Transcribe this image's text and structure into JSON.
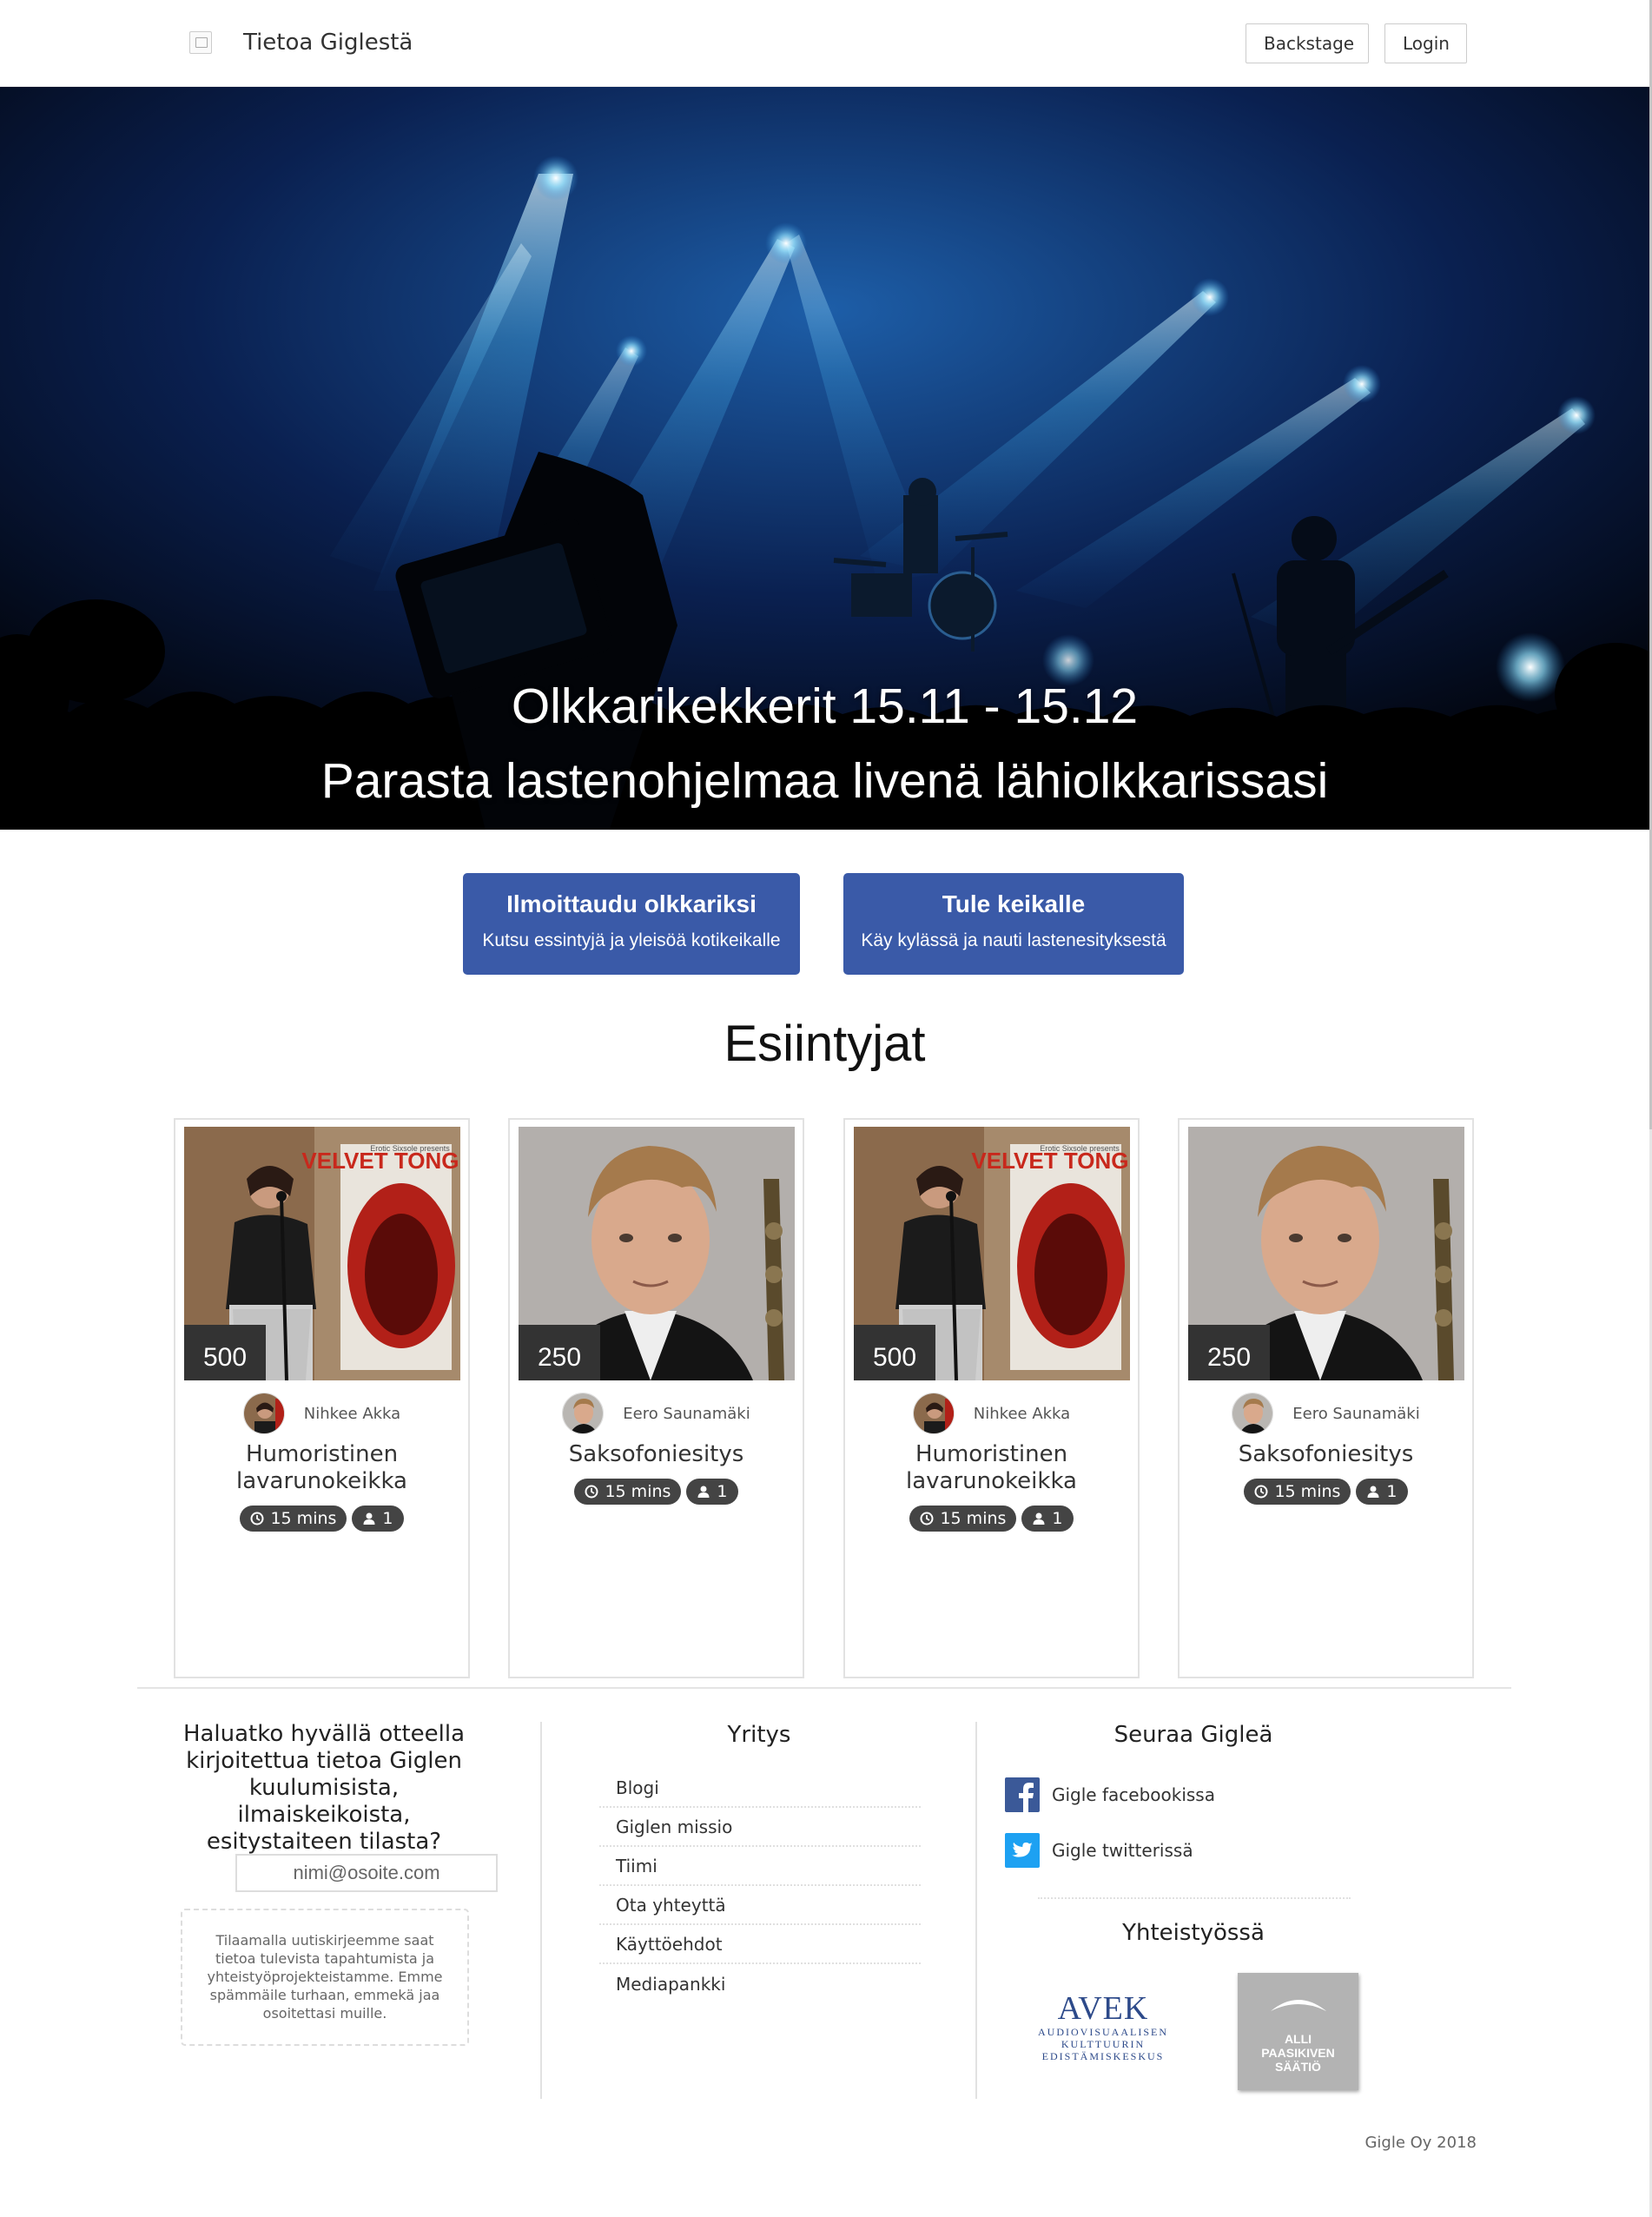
{
  "header": {
    "brand_title": "Tietoa Giglestä",
    "buttons": {
      "backstage": "Backstage",
      "login": "Login"
    }
  },
  "hero": {
    "line1": "Olkkarikekkerit 15.11 - 15.12",
    "line2": "Parasta lastenohjelmaa livenä lähiolkkarissasi"
  },
  "cta": [
    {
      "title": "Ilmoittaudu olkkariksi",
      "subtitle": "Kutsu essintyjä ja yleisöä kotikeikalle"
    },
    {
      "title": "Tule keikalle",
      "subtitle": "Käy kylässä ja nauti lastenesityksestä"
    }
  ],
  "performers_section": {
    "title": "Esiintyjat",
    "cards": [
      {
        "price": "500",
        "performer": "Nihkee Akka",
        "title": "Humoristinen lavarunokeikka",
        "duration": "15 mins",
        "persons": "1",
        "photo_icon": "velvet-tongue-poster",
        "poster_text": "VELVET TONGUE",
        "poster_small": "Erotic Sixsole presents"
      },
      {
        "price": "250",
        "performer": "Eero Saunamäki",
        "title": "Saksofoniesitys",
        "duration": "15 mins",
        "persons": "1",
        "photo_icon": "saxophonist-portrait"
      },
      {
        "price": "500",
        "performer": "Nihkee Akka",
        "title": "Humoristinen lavarunokeikka",
        "duration": "15 mins",
        "persons": "1",
        "photo_icon": "velvet-tongue-poster",
        "poster_text": "VELVET TONGUE",
        "poster_small": "Erotic Sixsole presents"
      },
      {
        "price": "250",
        "performer": "Eero Saunamäki",
        "title": "Saksofoniesitys",
        "duration": "15 mins",
        "persons": "1",
        "photo_icon": "saxophonist-portrait"
      }
    ]
  },
  "footer": {
    "newsletter": {
      "heading": "Haluatko hyvällä otteella kirjoitettua tietoa Giglen kuulumisista, ilmaiskeikoista, esitystaiteen tilasta?",
      "placeholder": "nimi@osoite.com",
      "note": "Tilaamalla uutiskirjeemme saat tietoa tulevista tapahtumista ja yhteistyöprojekteistamme. Emme spämmäile turhaan, emmekä jaa osoitettasi muille."
    },
    "company": {
      "heading": "Yritys",
      "links": [
        "Blogi",
        "Giglen missio",
        "Tiimi",
        "Ota yhteyttä",
        "Käyttöehdot",
        "Mediapankki"
      ]
    },
    "social": {
      "heading": "Seuraa Gigleä",
      "facebook": "Gigle facebookissa",
      "twitter": "Gigle twitterissä",
      "facebook_color": "#3b5998",
      "twitter_color": "#1da1f2"
    },
    "partners": {
      "heading": "Yhteistyössä",
      "avek": {
        "logo": "AVEK",
        "lines": [
          "AUDIOVISUAALISEN",
          "KULTTUURIN",
          "EDISTÄMISKESKUS"
        ]
      },
      "alli": "ALLI\nPAASIKIVEN\nSÄÄTIÖ"
    },
    "copyright": "Gigle Oy 2018"
  },
  "colors": {
    "accent": "#3a5aa8",
    "badge": "#333333",
    "pill": "#444444"
  }
}
